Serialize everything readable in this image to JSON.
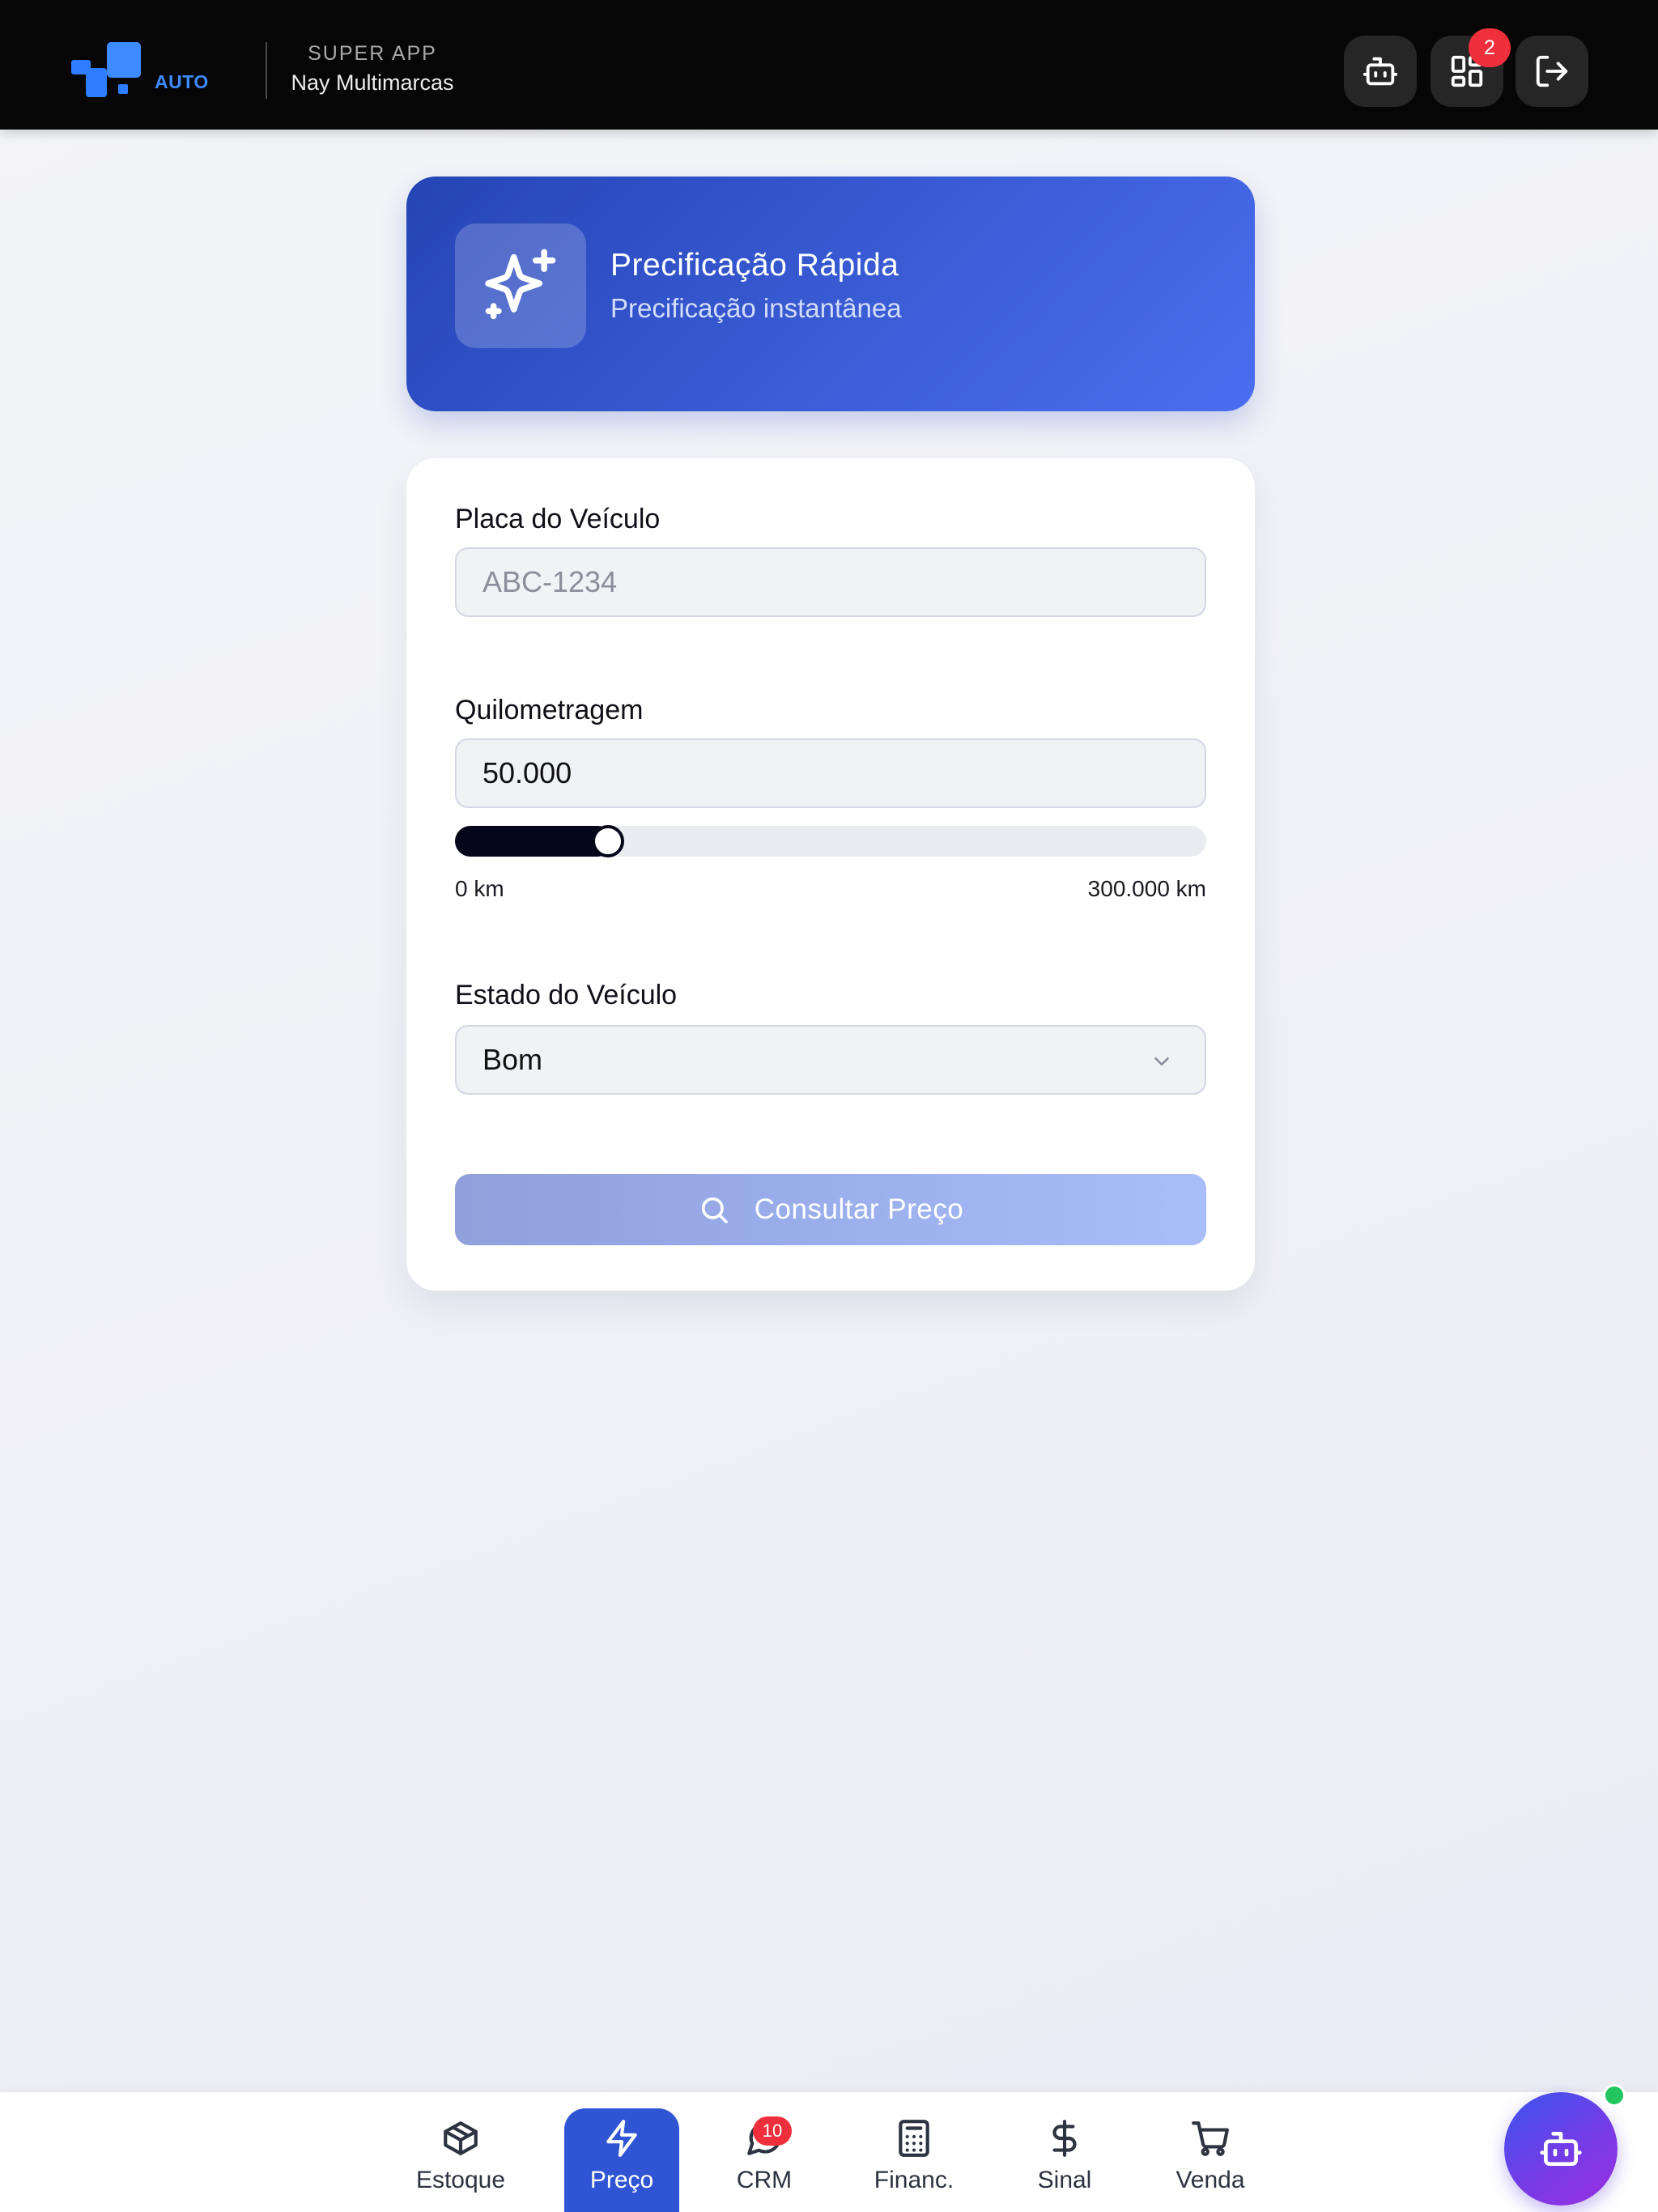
{
  "header": {
    "logo_text": "AUTO",
    "super_app": "SUPER APP",
    "company": "Nay Multimarcas",
    "apps_badge": "2",
    "icons": [
      "robot-icon",
      "grid-apps-icon",
      "logout-icon"
    ]
  },
  "hero": {
    "title": "Precificação Rápida",
    "subtitle": "Precificação instantânea",
    "icon": "sparkles-icon"
  },
  "form": {
    "plate": {
      "label": "Placa do Veículo",
      "value": "",
      "placeholder": "ABC-1234"
    },
    "mileage": {
      "label": "Quilometragem",
      "value": "50.000",
      "slider": {
        "min": 0,
        "max": 300000,
        "current": 50000
      },
      "min_label": "0 km",
      "max_label": "300.000 km"
    },
    "condition": {
      "label": "Estado do Veículo",
      "selected": "Bom"
    },
    "submit_label": "Consultar Preço"
  },
  "bottom_nav": {
    "items": [
      {
        "label": "Estoque",
        "icon": "box-icon"
      },
      {
        "label": "Preço",
        "icon": "lightning-icon",
        "active": true
      },
      {
        "label": "CRM",
        "icon": "chat-icon",
        "badge": "10"
      },
      {
        "label": "Financ.",
        "icon": "calculator-icon"
      },
      {
        "label": "Sinal",
        "icon": "dollar-icon"
      },
      {
        "label": "Venda",
        "icon": "cart-icon"
      }
    ]
  },
  "colors": {
    "header_bg": "#060606",
    "accent": "#2f54d4",
    "badge": "#ef2f3c",
    "online_dot": "#22c55e"
  }
}
